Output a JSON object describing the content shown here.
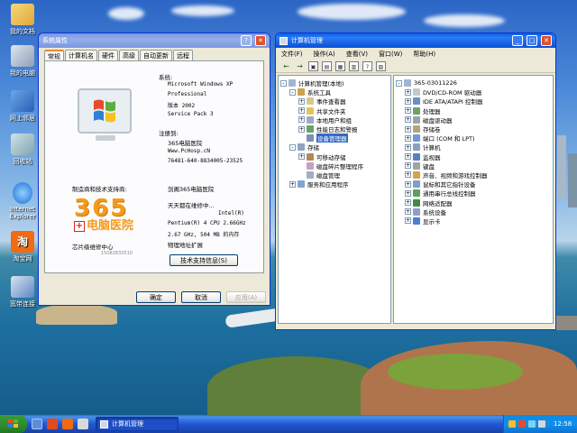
{
  "desktop": {
    "icons": [
      {
        "label": "我的文档"
      },
      {
        "label": "我的电脑"
      },
      {
        "label": "网上邻居"
      },
      {
        "label": "回收站"
      },
      {
        "label": "Internet Explorer"
      },
      {
        "label": "淘宝网"
      },
      {
        "label": "宽带连接"
      }
    ]
  },
  "sysprop": {
    "title": "系统属性",
    "tabs": [
      "常规",
      "计算机名",
      "硬件",
      "高级",
      "自动更新",
      "远程"
    ],
    "selected_tab": "常规",
    "system_label": "系统:",
    "system_lines": [
      "Microsoft Windows XP",
      "Professional",
      "版本 2002",
      "Service Pack 3"
    ],
    "registered_label": "注册到:",
    "registered_lines": [
      "365电脑医院",
      "Www.PcHosp.cN",
      "76481-640-8834005-23525"
    ],
    "maker_label": "制造商和技术支持商:",
    "maker_name": "剑阁365电脑医院",
    "maker_lines": [
      "天天都在维修中...",
      "Intel(R)",
      "Pentium(R) 4 CPU 2.66GHz",
      "2.67 GHz, 504 MB 的内存",
      "物理地址扩展"
    ],
    "logo_main": "365",
    "logo_sub": "电脑医院",
    "logo_caption": "芯片级维修中心",
    "logo_phone": "15082833510",
    "support_button": "技术支持信息(S)",
    "ok_button": "确定",
    "cancel_button": "取消",
    "apply_button": "应用(A)"
  },
  "compmgmt": {
    "title": "计算机管理",
    "menu": [
      "文件(F)",
      "操作(A)",
      "查看(V)",
      "窗口(W)",
      "帮助(H)"
    ],
    "tree": [
      {
        "label": "计算机管理(本地)",
        "level": 0,
        "exp": "-"
      },
      {
        "label": "系统工具",
        "level": 1,
        "exp": "-"
      },
      {
        "label": "事件查看器",
        "level": 2,
        "exp": "+"
      },
      {
        "label": "共享文件夹",
        "level": 2,
        "exp": "+"
      },
      {
        "label": "本地用户和组",
        "level": 2,
        "exp": "+"
      },
      {
        "label": "性能日志和警报",
        "level": 2,
        "exp": "+"
      },
      {
        "label": "设备管理器",
        "level": 2,
        "exp": "",
        "selected": true
      },
      {
        "label": "存储",
        "level": 1,
        "exp": "-"
      },
      {
        "label": "可移动存储",
        "level": 2,
        "exp": "+"
      },
      {
        "label": "磁盘碎片整理程序",
        "level": 2,
        "exp": ""
      },
      {
        "label": "磁盘管理",
        "level": 2,
        "exp": ""
      },
      {
        "label": "服务和应用程序",
        "level": 1,
        "exp": "+"
      }
    ],
    "device_root": "365-03011226",
    "devices": [
      "DVD/CD-ROM 驱动器",
      "IDE ATA/ATAPI 控制器",
      "处理器",
      "磁盘驱动器",
      "存储卷",
      "端口 (COM 和 LPT)",
      "计算机",
      "监视器",
      "键盘",
      "声音、视频和游戏控制器",
      "鼠标和其它指针设备",
      "通用串行总线控制器",
      "网络适配器",
      "系统设备",
      "显示卡"
    ]
  },
  "taskbar": {
    "task_label": "计算机管理",
    "clock": "12:58"
  },
  "colors": {
    "xp_blue": "#0a5fe8",
    "selection": "#316ac5",
    "logo_orange": "#f59a1a"
  }
}
